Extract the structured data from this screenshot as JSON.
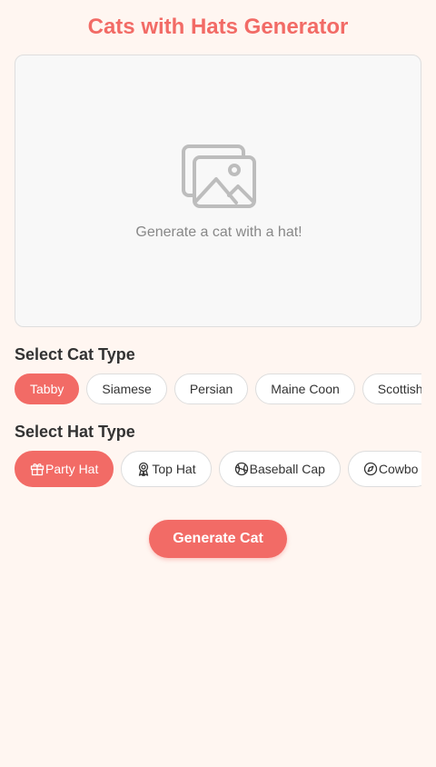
{
  "app": {
    "title": "Cats with Hats Generator"
  },
  "preview": {
    "placeholder_icon": "image-icon",
    "placeholder_text": "Generate a cat with a hat!"
  },
  "cat_section": {
    "label": "Select Cat Type",
    "options": [
      "Tabby",
      "Siamese",
      "Persian",
      "Maine Coon",
      "Scottish"
    ],
    "selected": "Tabby"
  },
  "hat_section": {
    "label": "Select Hat Type",
    "options": [
      {
        "label": "Party Hat",
        "icon": "gift-icon"
      },
      {
        "label": "Top Hat",
        "icon": "award-icon"
      },
      {
        "label": "Baseball Cap",
        "icon": "baseball-icon"
      },
      {
        "label": "Cowbo",
        "icon": "compass-icon"
      }
    ],
    "selected": "Party Hat"
  },
  "generate_button": {
    "label": "Generate Cat"
  },
  "colors": {
    "accent": "#f26b66",
    "background": "#fff6f1",
    "preview_bg": "#f8f8f8"
  }
}
